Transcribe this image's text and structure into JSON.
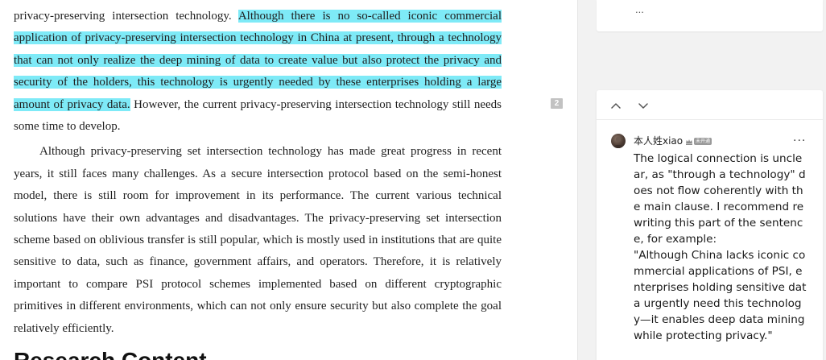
{
  "document": {
    "paragraphs": [
      {
        "before": "privacy-preserving intersection technology. ",
        "highlight": "Although there is no so-called iconic commercial application of privacy-preserving intersection technology in China at present, through a technology that can not only realize the deep mining of data to create value but also protect the privacy and security of the holders, this technology is urgently needed by these enterprises holding a large amount of privacy data.",
        "after": " However, the current privacy-preserving intersection technology still needs some time to develop."
      },
      {
        "text": "Although privacy-preserving set intersection technology has made great progress in recent years, it still faces many challenges. As a secure intersection protocol based on the semi-honest model, there is still room for improvement in its performance. The current various technical solutions have their own advantages and disadvantages. The privacy-preserving set intersection scheme based on oblivious transfer is still popular, which is mostly used in institutions that are quite sensitive to data, such as finance, government affairs, and operators. Therefore, it is relatively important to compare PSI protocol schemes implemented based on different cryptographic primitives in different environments, which can not only ensure security but also complete the goal relatively efficiently."
      }
    ],
    "next_heading": "Research Content",
    "page_marker": "2"
  },
  "comments_panel": {
    "previous_card_text": "...",
    "comment": {
      "author": "本人姓xiao",
      "badge_label": "未开通",
      "more_label": "...",
      "text": "The logical connection is unclear, as \"through a technology\" does not flow coherently with the main clause. I recommend rewriting this part of the sentence, for example:\n\"Although China lacks iconic commercial applications of PSI, enterprises holding sensitive data urgently need this technology—it enables deep data mining while protecting privacy.\""
    },
    "icons": {
      "nav_up": "chevron-up-icon",
      "nav_down": "chevron-down-icon",
      "badge": "vip-crown-icon",
      "more": "more-options-icon"
    }
  },
  "colors": {
    "highlight": "#7eeaf7",
    "panel_background": "#f2f2f2",
    "card_background": "#ffffff"
  }
}
